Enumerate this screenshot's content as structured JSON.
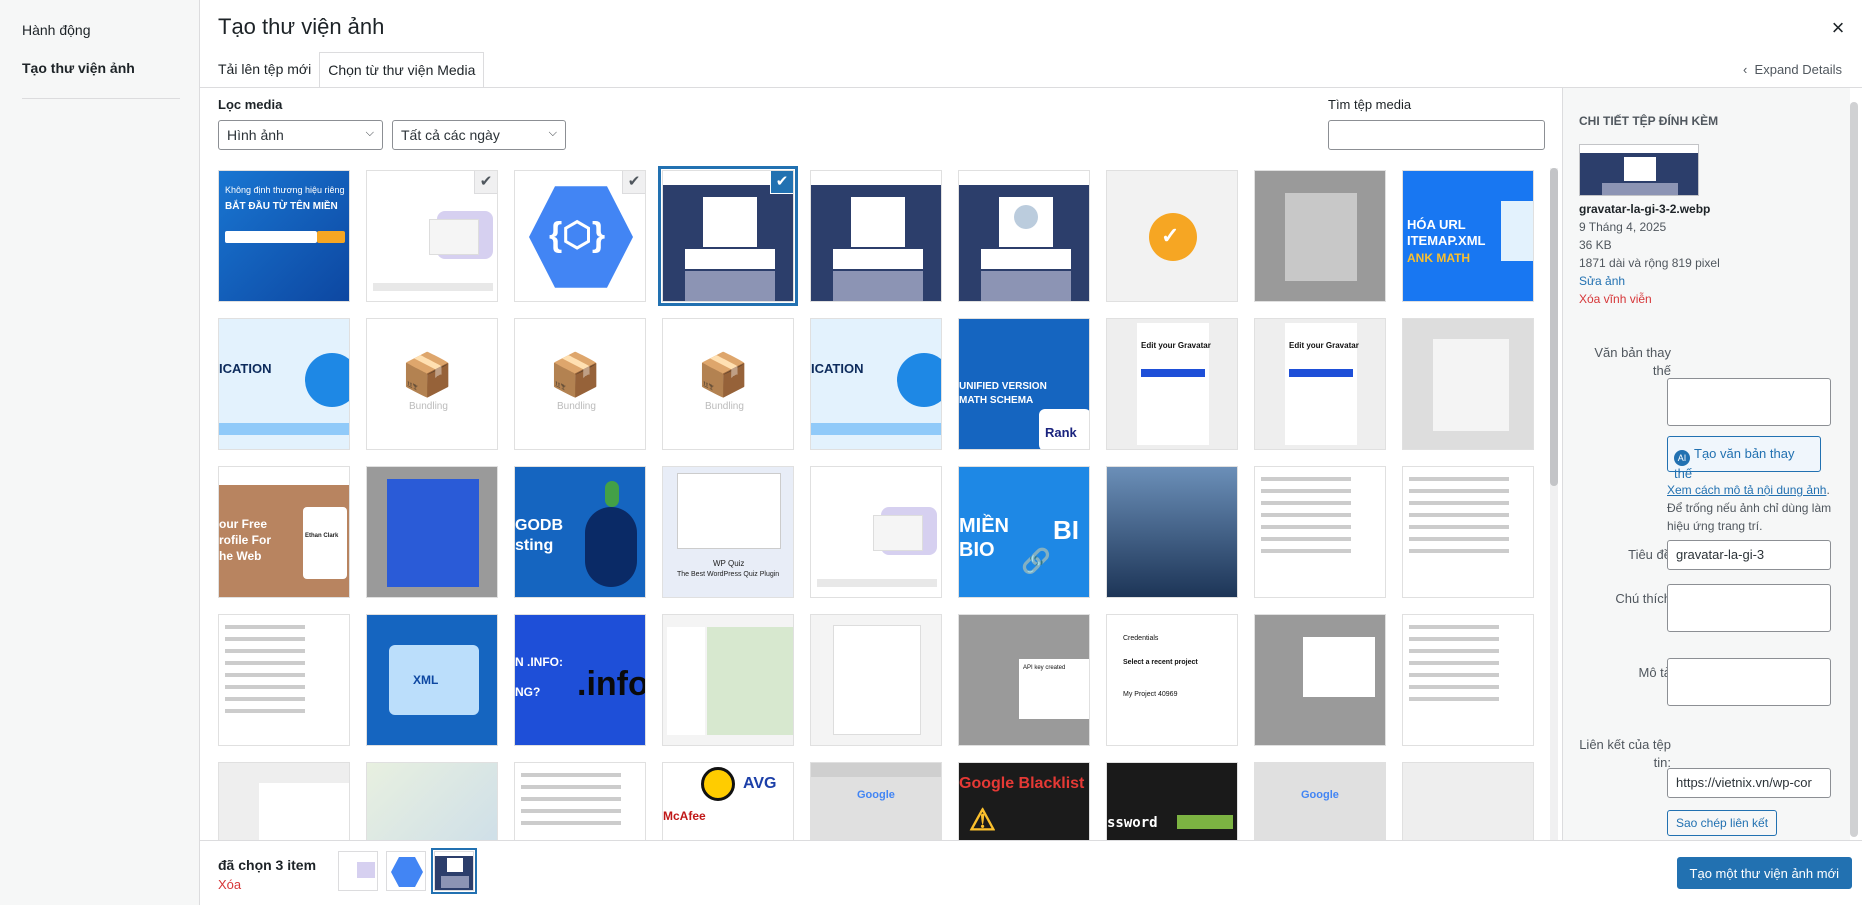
{
  "menu": {
    "heading": "Hành động",
    "item": "Tạo thư viện ảnh"
  },
  "modal": {
    "title": "Tạo thư viện ảnh",
    "close_glyph": "×"
  },
  "tabs": [
    {
      "label": "Tải lên tệp mới"
    },
    {
      "label": "Chọn từ thư viện Media"
    }
  ],
  "expand_details": "Expand Details",
  "toolbar": {
    "filter_label": "Lọc media",
    "type_select": "Hình ảnh",
    "date_select": "Tất cả các ngày",
    "search_label": "Tìm tệp media",
    "search_value": ""
  },
  "thumb_text": {
    "t0": "Không định thương hiệu riêng",
    "t0b": "BẮT ĐẦU TỪ TÊN MIỀN",
    "t8a": "HÓA URL",
    "t8b": "ITEMAP.XML",
    "t8c": "ANK MATH",
    "t9": "ICATION",
    "t10": "Bundling",
    "t14a": "UNIFIED VERSION",
    "t14b": "MATH SCHEMA",
    "t14c": "Rank",
    "t15": "Edit your Gravatar",
    "t18a": "our Free",
    "t18b": "rofile For",
    "t18c": "he Web",
    "t18d": "Ethan Clark",
    "t20a": "GODB",
    "t20b": "sting",
    "t21a": "WP Quiz",
    "t21b": "The Best WordPress Quiz Plugin",
    "t23a": "MIỀN",
    "t23b": "BIO",
    "t23c": "BI",
    "t28": "XML",
    "t29a": "N .INFO:",
    "t29b": "NG?",
    "t29c": ".info",
    "t32": "API key created",
    "t33a": "Credentials",
    "t33b": "Select a recent project",
    "t33c": "My Project 40969",
    "t37": "Google",
    "t38": "AVG",
    "t38b": "McAfee",
    "t39": "Google Blacklist",
    "t40": "ssword",
    "t41": "Google"
  },
  "details": {
    "heading": "Chi tiết tệp đính kèm",
    "filename": "gravatar-la-gi-3-2.webp",
    "date": "9 Tháng 4, 2025",
    "size": "36 KB",
    "dimensions": "1871 dài và rộng 819 pixel",
    "edit_link": "Sửa ảnh",
    "delete_link": "Xóa vĩnh viễn",
    "alt_label": "Văn bản thay thế",
    "alt_value": "",
    "ai_button": "Tạo văn bản thay thế",
    "hint_link": "Xem cách mô tả nội dung ảnh",
    "hint_text": ". Để trống nếu ảnh chỉ dùng làm hiệu ứng trang trí.",
    "title_label": "Tiêu đề",
    "title_value": "gravatar-la-gi-3",
    "caption_label": "Chú thích",
    "desc_label": "Mô tả",
    "url_label": "Liên kết của tệp tin:",
    "url_value": "https://vietnix.vn/wp-cor",
    "copy_button": "Sao chép liên kết"
  },
  "bottom": {
    "selected_count": "đã chọn 3 item",
    "clear": "Xóa",
    "primary_button": "Tạo một thư viện ảnh mới"
  },
  "colors": {
    "accent": "#2271b1",
    "danger": "#d63638"
  }
}
